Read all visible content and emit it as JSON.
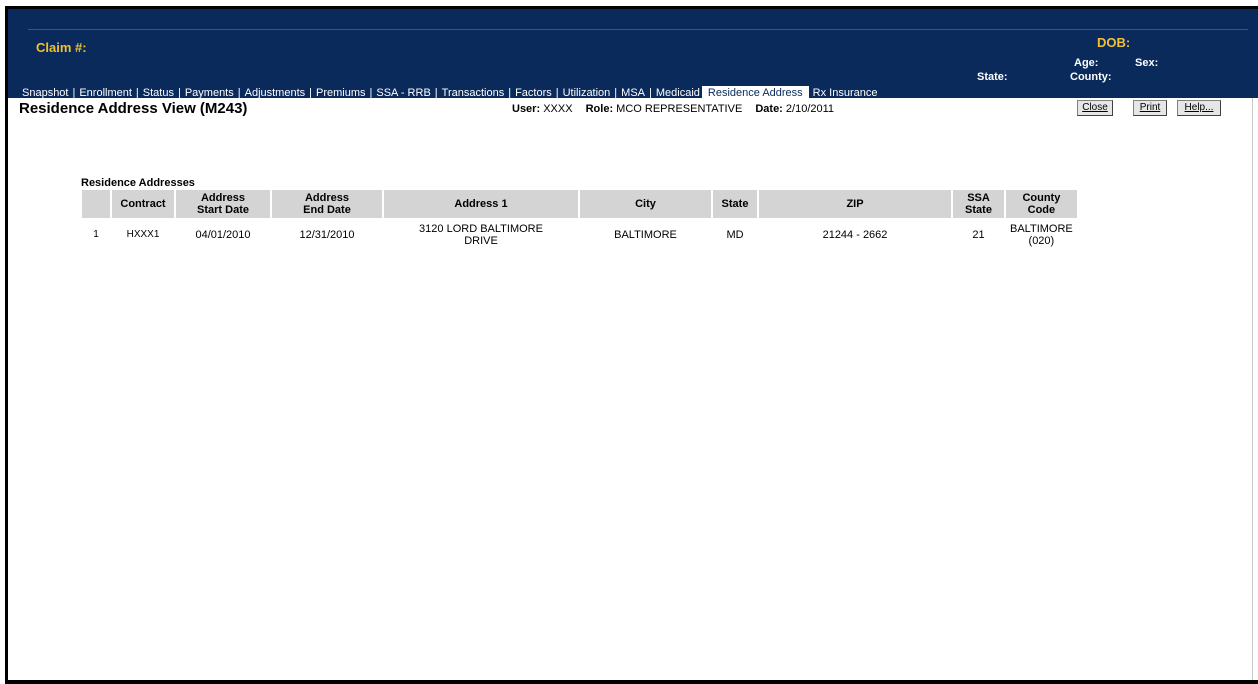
{
  "header": {
    "claim_label": "Claim #:",
    "dob_label": "DOB:",
    "age_label": "Age:",
    "sex_label": "Sex:",
    "state_label": "State:",
    "county_label": "County:"
  },
  "nav": {
    "tabs": [
      {
        "label": "Snapshot"
      },
      {
        "label": "Enrollment"
      },
      {
        "label": "Status"
      },
      {
        "label": "Payments"
      },
      {
        "label": "Adjustments"
      },
      {
        "label": "Premiums"
      },
      {
        "label": "SSA - RRB"
      },
      {
        "label": "Transactions"
      },
      {
        "label": "Factors"
      },
      {
        "label": "Utilization"
      },
      {
        "label": "MSA"
      },
      {
        "label": "Medicaid"
      }
    ],
    "active_tab": "Residence Address",
    "last_tab": "Rx Insurance",
    "separator": "|"
  },
  "page": {
    "title": "Residence Address View (M243)",
    "user_label": "User:",
    "user_value": "XXXX",
    "role_label": "Role:",
    "role_value": "MCO REPRESENTATIVE",
    "date_label": "Date:",
    "date_value": "2/10/2011"
  },
  "buttons": {
    "close": "Close",
    "print": "Print",
    "help": "Help..."
  },
  "table": {
    "section_title": "Residence Addresses",
    "columns": {
      "contract": "Contract",
      "start_1": "Address",
      "start_2": "Start Date",
      "end_1": "Address",
      "end_2": "End Date",
      "address1": "Address 1",
      "city": "City",
      "state": "State",
      "zip": "ZIP",
      "ssa_1": "SSA",
      "ssa_2": "State",
      "county_1": "County",
      "county_2": "Code"
    },
    "rows": [
      {
        "num": "1",
        "contract": "HXXX1",
        "start_date": "04/01/2010",
        "end_date": "12/31/2010",
        "address1_line1": "3120 LORD BALTIMORE",
        "address1_line2": "DRIVE",
        "city": "BALTIMORE",
        "state": "MD",
        "zip": "21244 - 2662",
        "ssa_state": "21",
        "county_line1": "BALTIMORE",
        "county_line2": "(020)"
      }
    ]
  }
}
